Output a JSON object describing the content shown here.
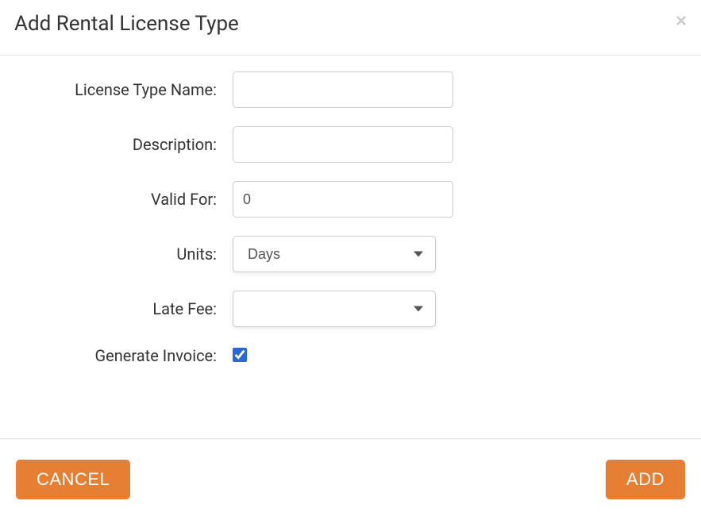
{
  "header": {
    "title": "Add Rental License Type"
  },
  "form": {
    "licenseTypeName": {
      "label": "License Type Name:",
      "value": ""
    },
    "description": {
      "label": "Description:",
      "value": ""
    },
    "validFor": {
      "label": "Valid For:",
      "value": "0"
    },
    "units": {
      "label": "Units:",
      "selected": "Days"
    },
    "lateFee": {
      "label": "Late Fee:",
      "selected": ""
    },
    "generateInvoice": {
      "label": "Generate Invoice:",
      "checked": true
    }
  },
  "footer": {
    "cancel": "CANCEL",
    "add": "ADD"
  }
}
